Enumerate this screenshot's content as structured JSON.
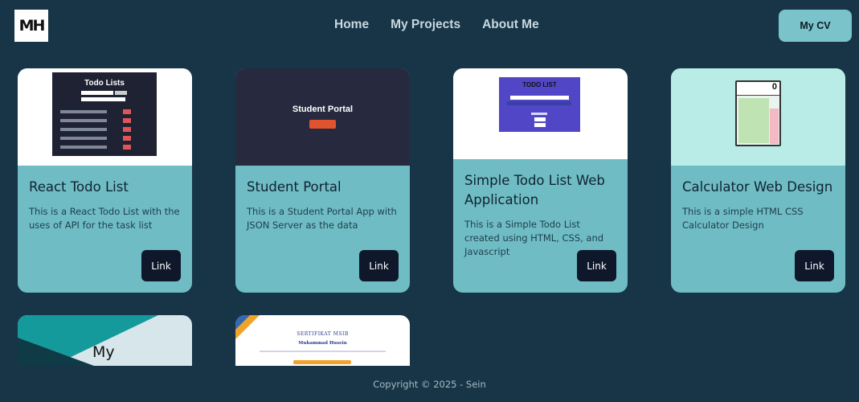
{
  "header": {
    "logo_text": "MH",
    "nav": [
      "Home",
      "My Projects",
      "About Me"
    ],
    "cv_button": "My CV"
  },
  "cards": [
    {
      "title": "React Todo List",
      "description": "This is a React Todo List with the uses of API for the task list",
      "link_label": "Link",
      "thumb_text": "Todo Lists"
    },
    {
      "title": "Student Portal",
      "description": "This is a Student Portal App with JSON Server as the data",
      "link_label": "Link",
      "thumb_text": "Student Portal"
    },
    {
      "title": "Simple Todo List Web Application",
      "description": "This is a Simple Todo List created using HTML, CSS, and Javascript",
      "link_label": "Link",
      "thumb_text": "TODO LIST"
    },
    {
      "title": "Calculator Web Design",
      "description": "This is a simple HTML CSS Calculator Design",
      "link_label": "Link",
      "thumb_text": "0"
    }
  ],
  "partial_cards": [
    {
      "thumb_text": "My"
    },
    {
      "thumb_text": "SERTIFIKAT MSIB",
      "thumb_name": "Muhammad Husein"
    }
  ],
  "footer": {
    "copyright": "Copyright © 2025 - Sein"
  },
  "colors": {
    "background": "#173546",
    "card": "#6fbcc4",
    "link_button": "#0f172a",
    "cv_button": "#7ac3ca"
  }
}
